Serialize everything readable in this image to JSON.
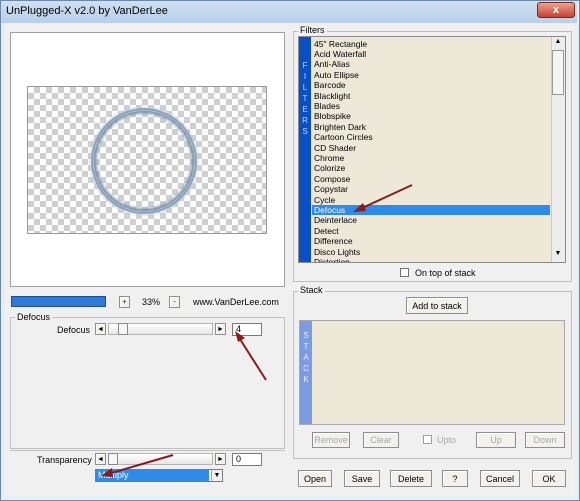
{
  "window": {
    "title": "UnPlugged-X v2.0 by VanDerLee",
    "close_glyph": "x"
  },
  "preview": {
    "zoom_minus": "-",
    "zoom_plus": "+",
    "zoom_level": "33%",
    "url": "www.VanDerLee.com"
  },
  "defocus": {
    "group_title": "Defocus",
    "param_label": "Defocus",
    "param_value": "4",
    "slider_fraction": 0.02
  },
  "transparency": {
    "label": "Transparency",
    "value": "0"
  },
  "blend": {
    "selected": "Multiply"
  },
  "filters": {
    "group_title": "Filters",
    "side_label": [
      "F",
      "I",
      "L",
      "T",
      "E",
      "R",
      "S"
    ],
    "items": [
      "45\" Rectangle",
      "Acid Waterfall",
      "Anti-Alias",
      "Auto Ellipse",
      "Barcode",
      "Blacklight",
      "Blades",
      "Blobspike",
      "Brighten Dark",
      "Cartoon Circles",
      "CD Shader",
      "Chrome",
      "Colorize",
      "Compose",
      "Copystar",
      "Cycle",
      "Defocus",
      "Deinterlace",
      "Detect",
      "Difference",
      "Disco Lights",
      "Distortion"
    ],
    "selected": "Defocus",
    "on_top_label": "On top of stack"
  },
  "stack": {
    "group_title": "Stack",
    "side_label": [
      "S",
      "T",
      "A",
      "C",
      "K"
    ],
    "add_button": "Add to stack",
    "remove_button": "Remove",
    "clear_button": "Clear",
    "upto_label": "Upto",
    "up_button": "Up",
    "down_button": "Down"
  },
  "bottom_buttons": {
    "open": "Open",
    "save": "Save",
    "delete": "Delete",
    "help": "?",
    "cancel": "Cancel",
    "ok": "OK"
  },
  "colors": {
    "selection": "#2f8bea",
    "strip": "#0a4fc7",
    "arrow": "#8b1a1a"
  }
}
